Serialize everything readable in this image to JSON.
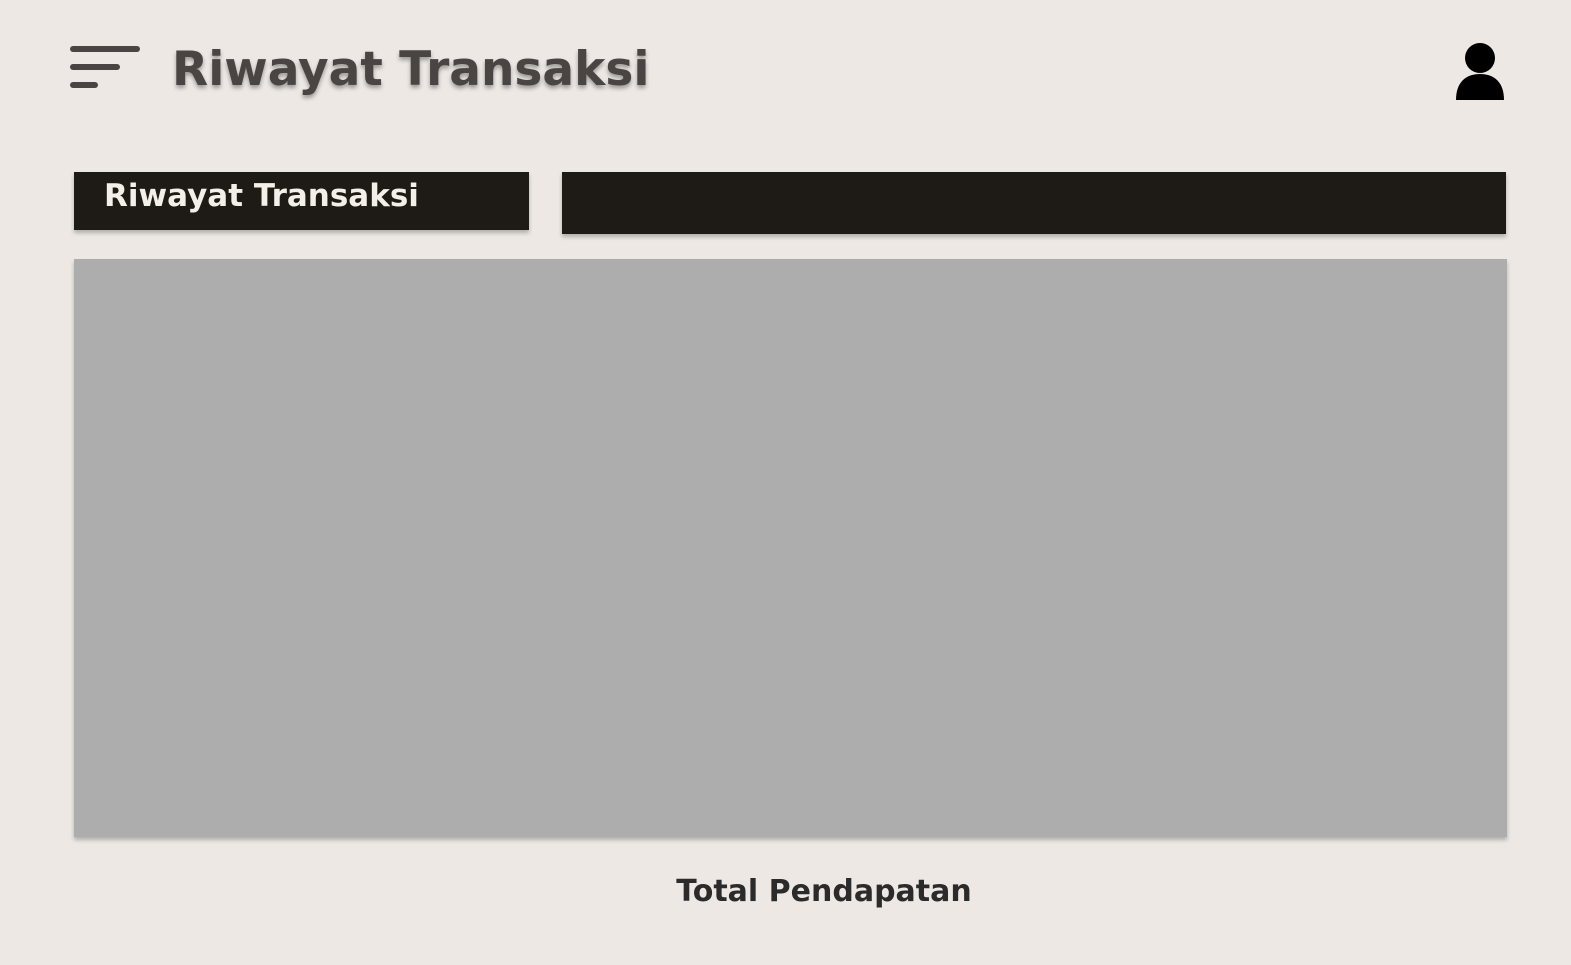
{
  "header": {
    "title": "Riwayat Transaksi",
    "menu_icon": "menu-icon",
    "user_icon": "user-icon"
  },
  "tabs": {
    "active_label": "Riwayat Transaksi"
  },
  "footer": {
    "total_label": "Total Pendapatan"
  },
  "colors": {
    "background": "#ede8e4",
    "title_text": "#4a4543",
    "dark_bar": "#1e1a15",
    "panel": "#adadad"
  }
}
